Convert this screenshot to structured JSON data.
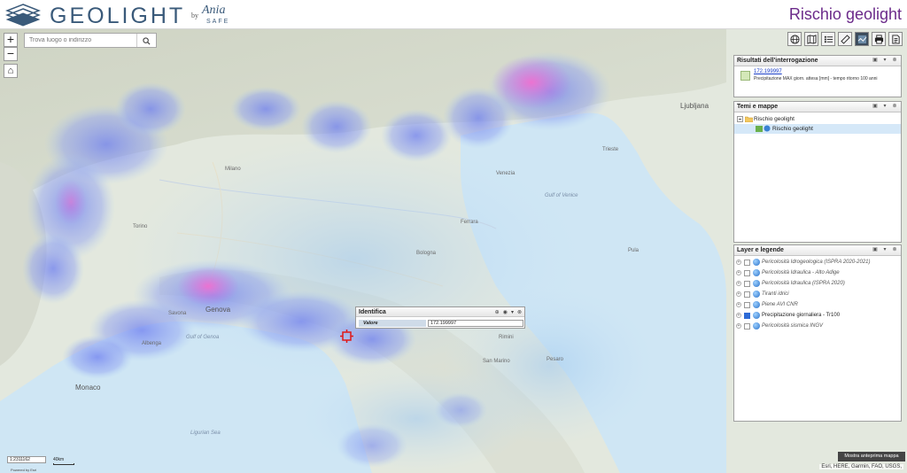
{
  "header": {
    "logo_text": "GEOLIGHT",
    "logo_by": "by",
    "logo_brand": "Ania",
    "logo_brand_sub": "SAFE",
    "app_title": "Rischio geolight"
  },
  "search": {
    "placeholder": "Trova luogo o indirizzo"
  },
  "map_controls": {
    "zoom_in": "+",
    "zoom_out": "−",
    "home": "⌂"
  },
  "toolbar": {
    "tools": [
      {
        "icon": "globe-icon"
      },
      {
        "icon": "map-book-icon"
      },
      {
        "icon": "legend-list-icon"
      },
      {
        "icon": "measure-icon"
      },
      {
        "icon": "basemap-icon"
      },
      {
        "icon": "print-icon"
      },
      {
        "icon": "report-icon"
      }
    ]
  },
  "results_panel": {
    "title": "Risultati dell'interrogazione",
    "value": "172.199997",
    "description": "Precipitazione MAX giorn. attesa [mm] - tempo ritorno 100 anni"
  },
  "themes_panel": {
    "title": "Temi e mappe",
    "group": "Rischio geolight",
    "layer": "Rischio geolight"
  },
  "layers_panel": {
    "title": "Layer e legende",
    "layers": [
      {
        "label": "Pericolosità Idrogeologica (ISPRA 2020-2021)",
        "checked": false
      },
      {
        "label": "Pericolosità Idraulica - Alto Adige",
        "checked": false
      },
      {
        "label": "Pericolosità Idraulica (ISPRA 2020)",
        "checked": false
      },
      {
        "label": "Tiranti idrici",
        "checked": false
      },
      {
        "label": "Piene AVI CNR",
        "checked": false
      },
      {
        "label": "Precipitazione giornaliera - Tr100",
        "checked": true
      },
      {
        "label": "Pericolosità sismica INGV",
        "checked": false
      }
    ]
  },
  "identify_popup": {
    "title": "Identifica",
    "key": "Valore",
    "value": "172.199997"
  },
  "map_labels": {
    "ljubljana": "Ljubljana",
    "trieste": "Trieste",
    "venezia": "Venezia",
    "milano": "Milano",
    "genova": "Genova",
    "monaco": "Monaco",
    "albenga": "Albenga",
    "savona": "Savona",
    "rimini": "Rimini",
    "pesaro": "Pesaro",
    "pola": "Pula",
    "san_marino": "San Marino",
    "golfo_venezia": "Gulf of Venice",
    "golfo_genova": "Gulf of Genoa",
    "mar_ligure": "Ligurian Sea",
    "ferrara": "Ferrara",
    "bologna": "Bologna",
    "torino": "Torino"
  },
  "scale": {
    "ratio": "1:2311162",
    "km": "40km"
  },
  "powered_by": "Powered by Esri",
  "preview_button": "Mostra anteprima mappa",
  "attribution": "Esri, HERE, Garmin, FAO, USGS,",
  "colors": {
    "title_purple": "#6b2a8a",
    "logo_blue": "#3a5a7a",
    "marker_red": "#e01818",
    "precip_blue": "#6d7ef0",
    "precip_pink": "#f070d0"
  }
}
